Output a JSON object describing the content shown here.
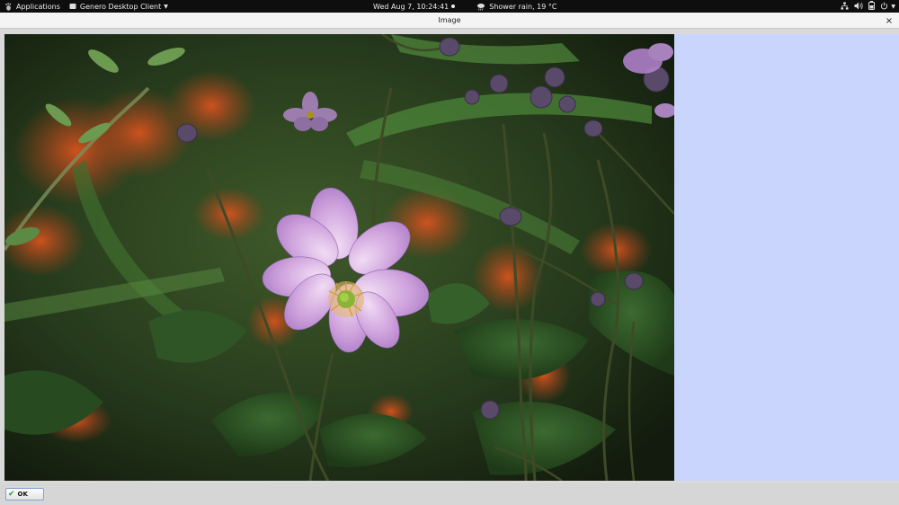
{
  "topbar": {
    "applications": "Applications",
    "app_menu": "Genero Desktop Client",
    "clock": "Wed Aug  7, 10:24:41",
    "weather": "Shower rain, 19 °C"
  },
  "window": {
    "title": "Image",
    "close_glyph": "×"
  },
  "main": {
    "image_alt": "Pink anemone flower with green center among dark foliage and orange blossoms",
    "background_color": "#c9d5fd"
  },
  "footer": {
    "ok_label": "OK"
  },
  "icons": [
    "gnome-foot-icon",
    "window-app-icon",
    "weather-icon",
    "network-icon",
    "volume-icon",
    "battery-icon",
    "power-icon",
    "close-icon",
    "checkmark-icon"
  ]
}
